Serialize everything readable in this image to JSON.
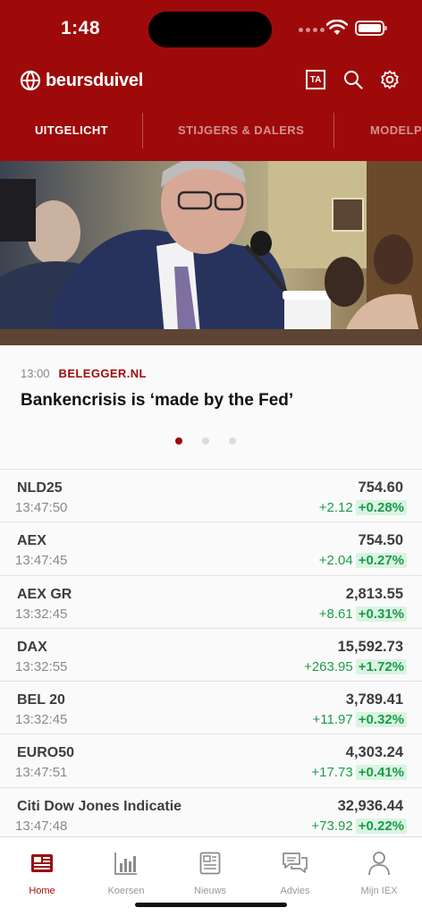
{
  "status_bar": {
    "time": "1:48"
  },
  "app_bar": {
    "logo_text": "beursduivel",
    "ta_label": "TA"
  },
  "tabs": [
    {
      "label": "UITGELICHT",
      "active": true
    },
    {
      "label": "STIJGERS & DALERS",
      "active": false
    },
    {
      "label": "MODELPO",
      "active": false
    }
  ],
  "featured": {
    "time": "13:00",
    "source": "BELEGGER.NL",
    "title": "Bankencrisis is ‘made by the Fed’",
    "page_index": 0,
    "page_count": 3
  },
  "quotes": [
    {
      "name": "NLD25",
      "time": "13:47:50",
      "value": "754.60",
      "change": "+2.12",
      "pct": "+0.28%"
    },
    {
      "name": "AEX",
      "time": "13:47:45",
      "value": "754.50",
      "change": "+2.04",
      "pct": "+0.27%"
    },
    {
      "name": "AEX GR",
      "time": "13:32:45",
      "value": "2,813.55",
      "change": "+8.61",
      "pct": "+0.31%"
    },
    {
      "name": "DAX",
      "time": "13:32:55",
      "value": "15,592.73",
      "change": "+263.95",
      "pct": "+1.72%"
    },
    {
      "name": "BEL 20",
      "time": "13:32:45",
      "value": "3,789.41",
      "change": "+11.97",
      "pct": "+0.32%"
    },
    {
      "name": "EURO50",
      "time": "13:47:51",
      "value": "4,303.24",
      "change": "+17.73",
      "pct": "+0.41%"
    },
    {
      "name": "Citi Dow Jones Indicatie",
      "time": "13:47:48",
      "value": "32,936.44",
      "change": "+73.92",
      "pct": "+0.22%"
    }
  ],
  "tabbar": [
    {
      "label": "Home",
      "icon": "newspaper-icon",
      "active": true
    },
    {
      "label": "Koersen",
      "icon": "bar-chart-icon",
      "active": false
    },
    {
      "label": "Nieuws",
      "icon": "document-icon",
      "active": false
    },
    {
      "label": "Advies",
      "icon": "chat-bubbles-icon",
      "active": false
    },
    {
      "label": "Mijn IEX",
      "icon": "person-icon",
      "active": false
    }
  ],
  "colors": {
    "brand": "#9e0a0a",
    "positive": "#1c9c4a",
    "positive_bg": "#d9f4e1"
  }
}
